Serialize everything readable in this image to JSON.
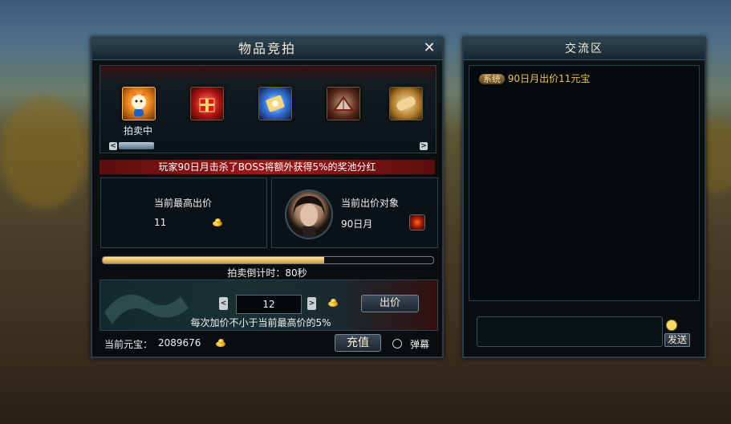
{
  "auction": {
    "title": "物品竞拍",
    "close_icon": "close-icon",
    "items": [
      {
        "icon": "fox-mascot-icon",
        "status": "拍卖中"
      },
      {
        "icon": "red-gift-box-icon"
      },
      {
        "icon": "glowing-scroll-icon"
      },
      {
        "icon": "red-book-icon"
      },
      {
        "icon": "parchment-scroll-icon"
      }
    ],
    "notice": "玩家90日月击杀了BOSS将额外获得5%的奖池分红",
    "highest_bid_label": "当前最高出价",
    "highest_bid_value": "11",
    "bidder_label": "当前出价对象",
    "bidder_name": "90日月",
    "countdown_progress": 0.67,
    "countdown_text": "拍卖倒计时：80秒",
    "bid_amount": "12",
    "bid_button": "出价",
    "bid_rule": "每次加价不小于当前最高价的5%",
    "balance_label": "当前元宝：",
    "balance_value": "2089676",
    "recharge_button": "充值",
    "barrage_label": "弹幕"
  },
  "chat": {
    "title": "交流区",
    "messages": [
      {
        "tag": "系统",
        "text": "90日月出价11元宝"
      }
    ],
    "input_value": "",
    "send_button": "发送"
  },
  "colors": {
    "accent_gold": "#e8b84a",
    "system_text": "#f0c060",
    "progress_fill": "#e6bd6e"
  }
}
